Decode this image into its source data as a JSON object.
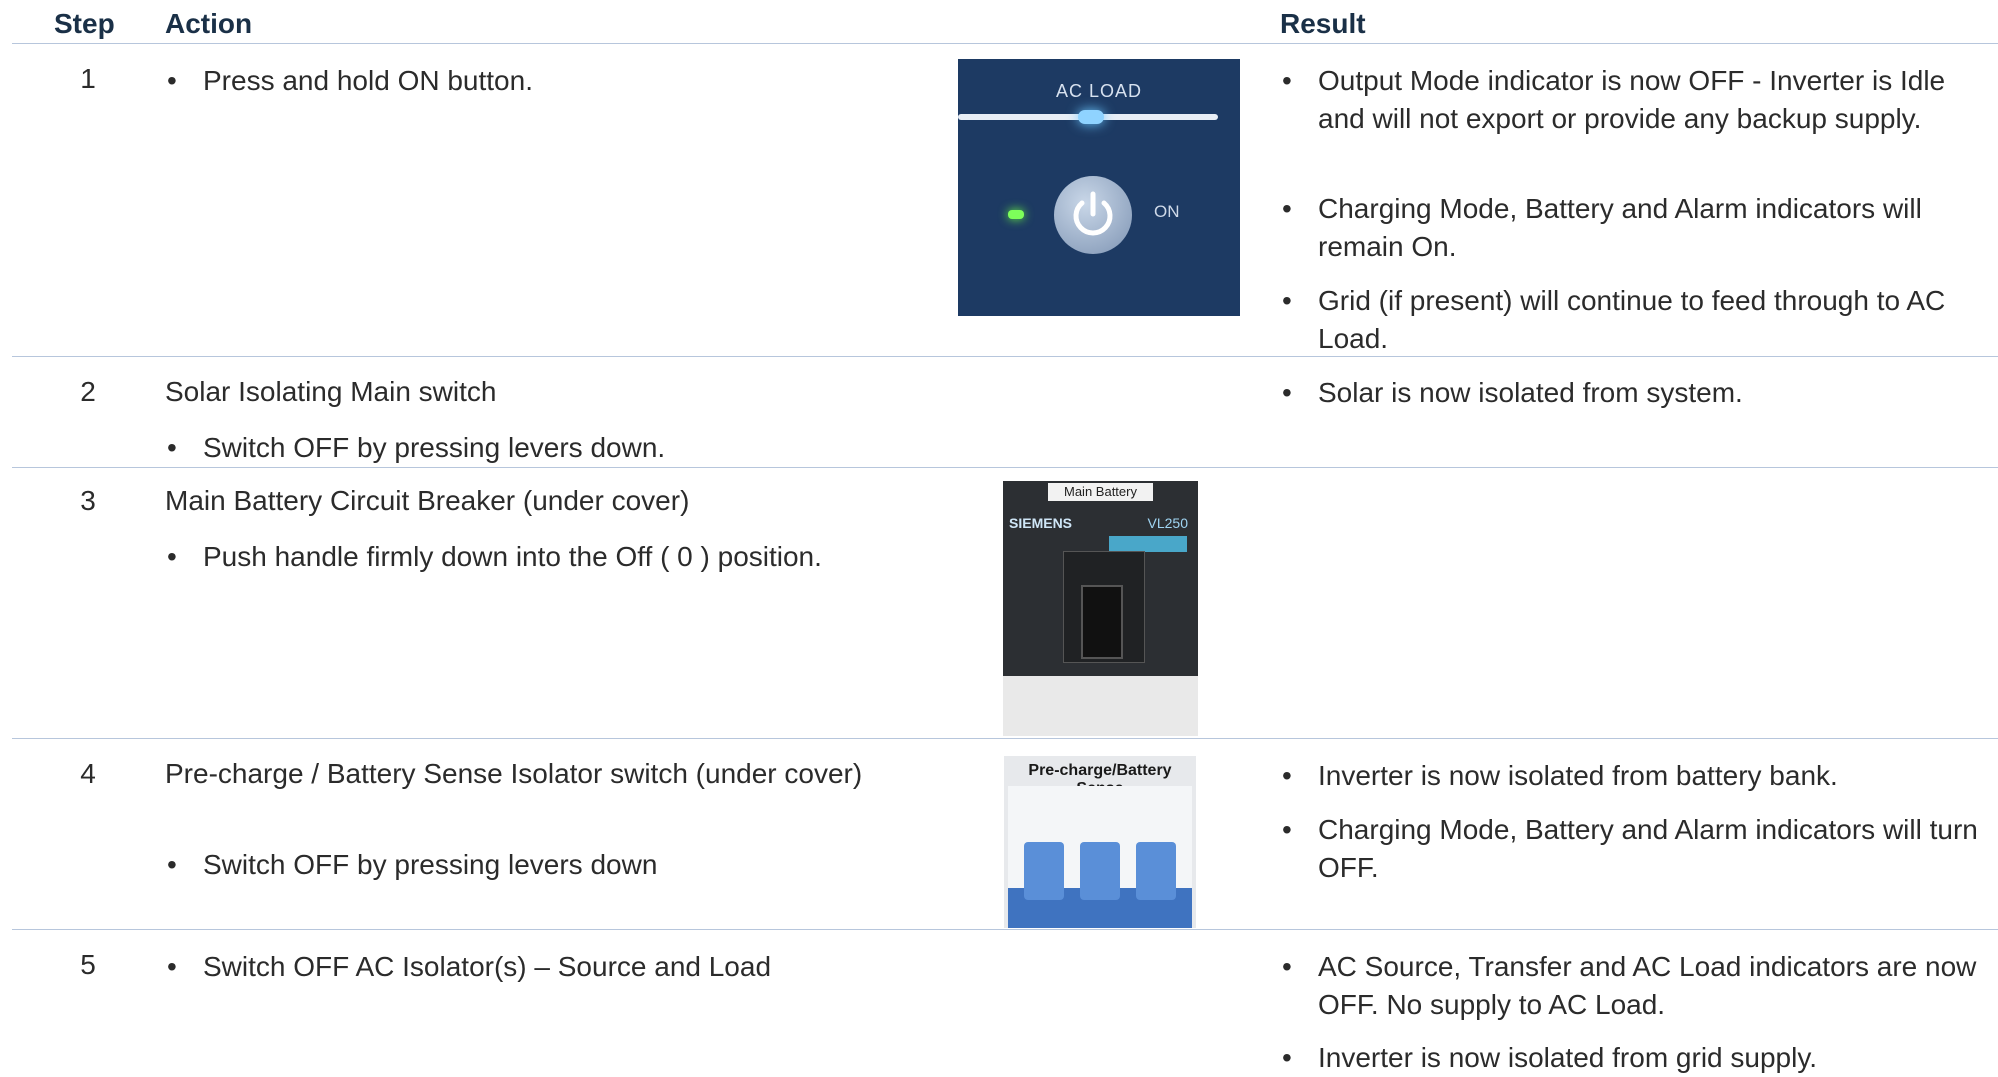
{
  "header": {
    "step": "Step",
    "action": "Action",
    "result": "Result"
  },
  "rows": [
    {
      "step": "1",
      "action_bullets": [
        "Press and hold ON button."
      ],
      "image": {
        "label": "AC LOAD",
        "button_text": "ON"
      },
      "result_bullets": [
        "Output Mode indicator is now OFF - Inverter is Idle and will not export or provide any backup supply.",
        "Charging Mode, Battery and Alarm indicators will remain On.",
        "Grid (if present) will continue to feed through to AC Load."
      ]
    },
    {
      "step": "2",
      "action_text": "Solar Isolating Main switch",
      "action_bullets": [
        "Switch OFF by pressing levers down."
      ],
      "result_bullets": [
        "Solar is now isolated from system."
      ]
    },
    {
      "step": "3",
      "action_text": "Main Battery Circuit Breaker (under cover)",
      "action_bullets": [
        "Push handle firmly down into the Off ( 0 ) position."
      ],
      "image": {
        "label": "Main Battery",
        "brand": "SIEMENS",
        "model": "VL250"
      }
    },
    {
      "step": "4",
      "action_text": "Pre-charge / Battery Sense Isolator switch (under cover)",
      "action_bullets": [
        "Switch OFF by pressing levers down"
      ],
      "image": {
        "label": "Pre-charge/Battery Sense"
      },
      "result_bullets": [
        "Inverter is now isolated from battery bank.",
        "Charging Mode, Battery and Alarm indicators will turn OFF."
      ]
    },
    {
      "step": "5",
      "action_bullets": [
        "Switch OFF AC Isolator(s) – Source and Load"
      ],
      "result_bullets": [
        "AC Source, Transfer and AC Load indicators are now OFF.  No supply to AC Load.",
        "Inverter is now isolated from grid supply."
      ]
    }
  ]
}
